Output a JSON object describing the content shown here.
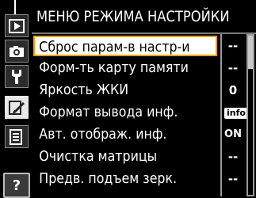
{
  "menu": {
    "title": "МЕНЮ РЕЖИМА НАСТРОЙКИ",
    "items": [
      {
        "label": "Сброс парам-в настр-и",
        "value": "--"
      },
      {
        "label": "Форм-ть карту памяти",
        "value": "--"
      },
      {
        "label": "Яркость ЖКИ",
        "value": "0"
      },
      {
        "label": "Формат вывода инф.",
        "value": "info"
      },
      {
        "label": "Авт. отображ. инф.",
        "value": "ON"
      },
      {
        "label": "Очистка матрицы",
        "value": "--"
      },
      {
        "label": "Предв. подъем зерк.",
        "value": "--"
      }
    ],
    "selected_index": 0,
    "help_label": "?"
  },
  "tabs": [
    {
      "icon": "playback-icon"
    },
    {
      "icon": "camera-icon"
    },
    {
      "icon": "custom-settings-wrench-icon"
    },
    {
      "icon": "setup-brush-icon"
    },
    {
      "icon": "retouch-list-icon"
    }
  ],
  "colors": {
    "background": "#000000",
    "selection_border": "#ff9f00",
    "selection_fill": "#ffffff",
    "text": "#ffffff"
  }
}
